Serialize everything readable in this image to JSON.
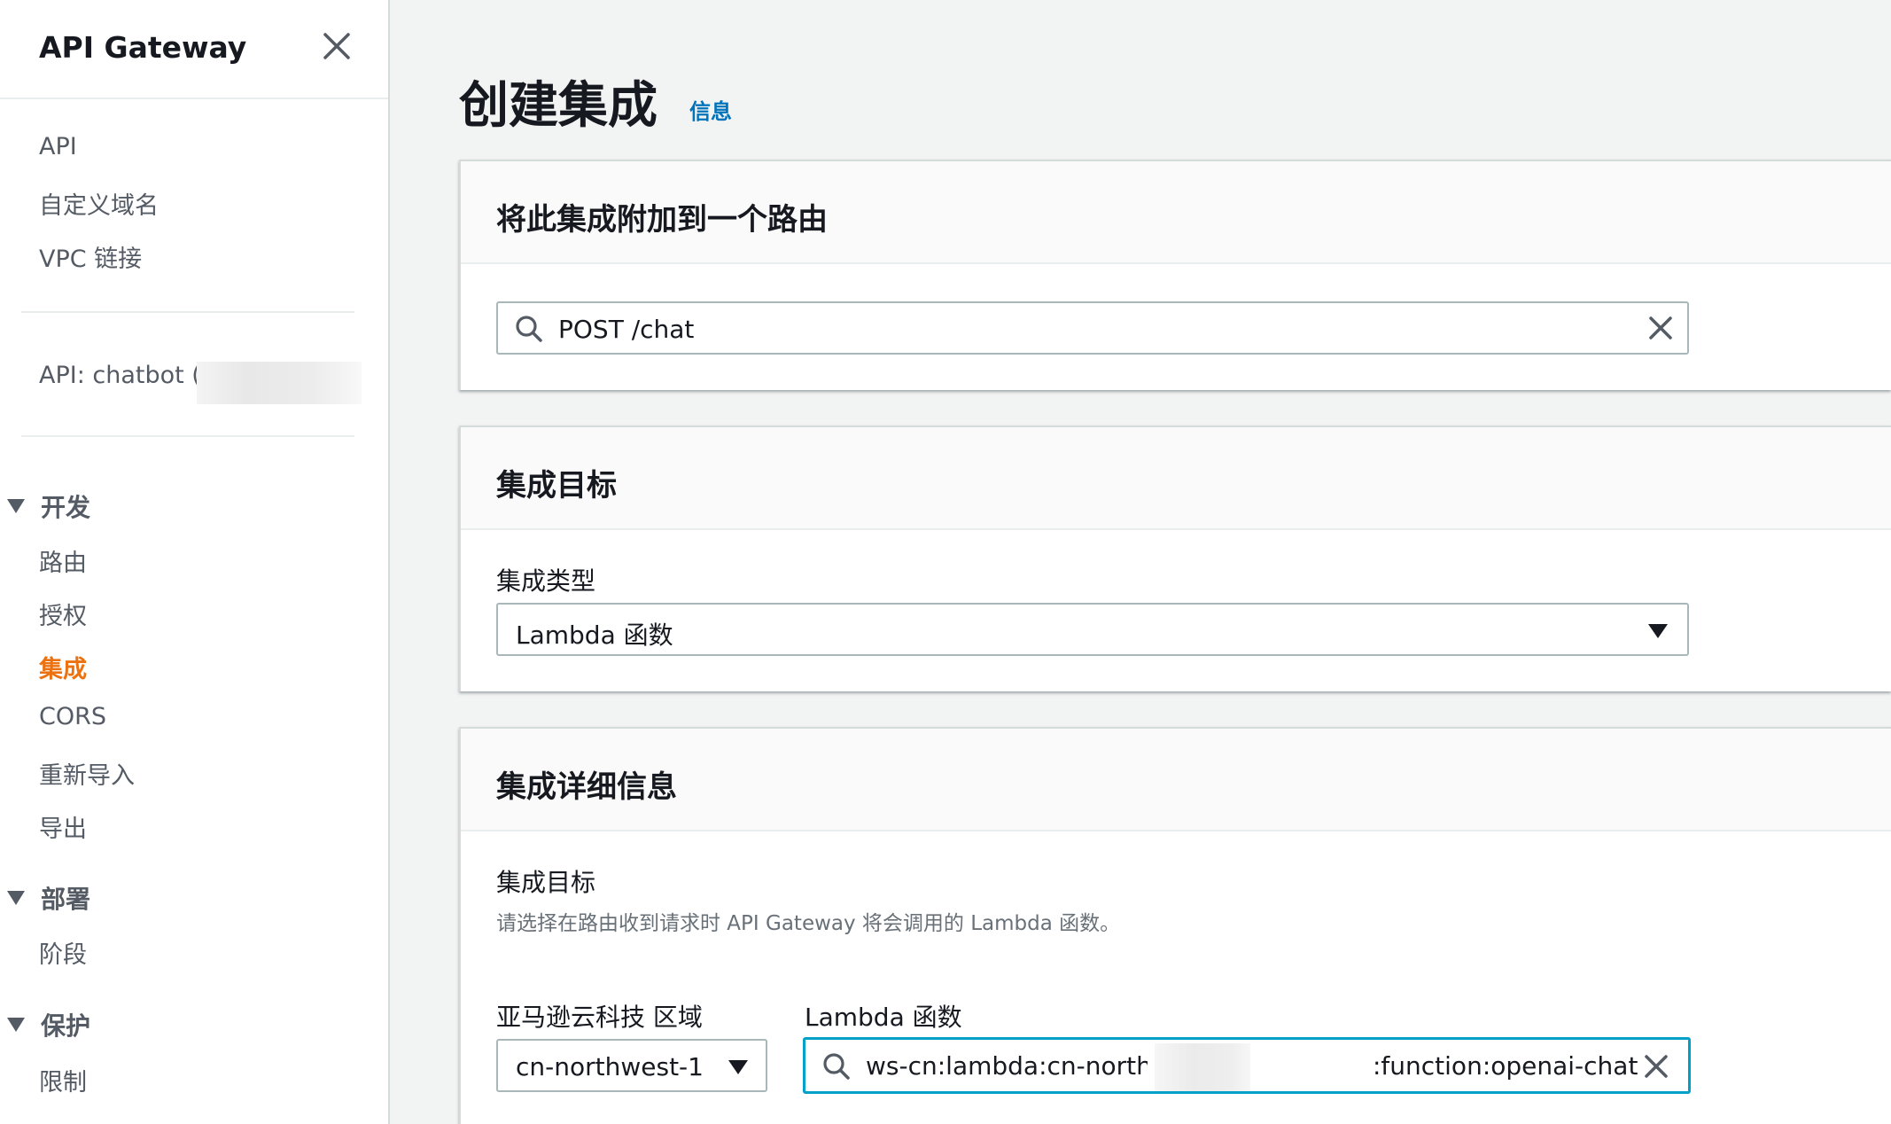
{
  "sidebar": {
    "title": "API Gateway",
    "top_links": [
      "API",
      "自定义域名",
      "VPC 链接"
    ],
    "api_label": "API: chatbot (c",
    "sections": {
      "develop": {
        "label": "开发",
        "items": [
          "路由",
          "授权",
          "集成",
          "CORS",
          "重新导入",
          "导出"
        ],
        "active": "集成"
      },
      "deploy": {
        "label": "部署",
        "items": [
          "阶段"
        ]
      },
      "protect": {
        "label": "保护",
        "items": [
          "限制"
        ]
      }
    }
  },
  "main": {
    "page_title": "创建集成",
    "info_link": "信息",
    "route_panel": {
      "title": "将此集成附加到一个路由",
      "route_value": "POST /chat"
    },
    "target_panel": {
      "title": "集成目标",
      "type_label": "集成类型",
      "type_value": "Lambda 函数"
    },
    "details_panel": {
      "title": "集成详细信息",
      "target_label": "集成目标",
      "target_desc": "请选择在路由收到请求时 API Gateway 将会调用的 Lambda 函数。",
      "region_label": "亚马逊云科技 区域",
      "region_value": "cn-northwest-1",
      "function_label": "Lambda 函数",
      "function_value_prefix": "ws-cn:lambda:cn-northwest-1:765",
      "function_value_suffix": ":function:openai-chat"
    }
  },
  "colors": {
    "accent_active": "#ec7211",
    "link": "#0073bb",
    "focus_border": "#00a1c9"
  }
}
